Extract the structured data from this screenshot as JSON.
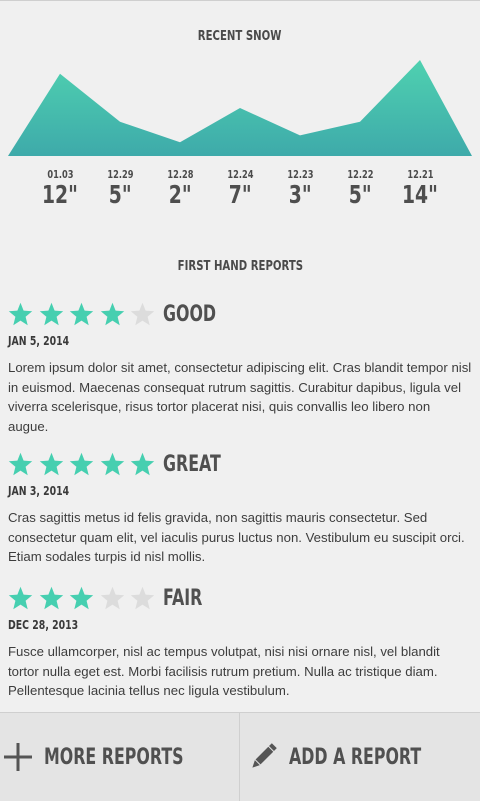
{
  "recent_snow": {
    "title": "RECENT SNOW",
    "colors": {
      "area_top": "#4fd1b0",
      "area_bottom": "#3eaaaa"
    },
    "chart_data": {
      "type": "area",
      "title": "RECENT SNOW",
      "x": [
        "01.03",
        "12.29",
        "12.28",
        "12.24",
        "12.23",
        "12.22",
        "12.21"
      ],
      "values": [
        12,
        5,
        2,
        7,
        3,
        5,
        14
      ],
      "value_labels": [
        "12\"",
        "5\"",
        "2\"",
        "7\"",
        "3\"",
        "5\"",
        "14\""
      ],
      "unit": "inches"
    }
  },
  "reports": {
    "title": "FIRST HAND REPORTS",
    "star_colors": {
      "filled": "#46cfb0",
      "empty": "#dcdcdc"
    },
    "items": [
      {
        "rating": 4,
        "max": 5,
        "label": "GOOD",
        "date": "JAN 5, 2014",
        "text": "Lorem ipsum dolor sit amet, consectetur adipiscing elit. Cras blandit tempor nisl in euismod. Maecenas consequat rutrum sagittis. Curabitur dapibus, ligula vel viverra scelerisque, risus tortor placerat nisi, quis convallis leo libero non augue."
      },
      {
        "rating": 5,
        "max": 5,
        "label": "GREAT",
        "date": "JAN 3, 2014",
        "text": "Cras sagittis metus id felis gravida, non sagittis mauris consectetur. Sed consectetur quam elit, vel iaculis purus luctus non. Vestibulum eu suscipit orci. Etiam sodales turpis id nisl mollis."
      },
      {
        "rating": 3,
        "max": 5,
        "label": "FAIR",
        "date": "DEC 28, 2013",
        "text": "Fusce ullamcorper, nisl ac tempus volutpat, nisi nisi ornare nisl, vel blandit tortor nulla eget est. Morbi facilisis rutrum pretium. Nulla ac tristique diam. Pellentesque lacinia tellus nec ligula vestibulum."
      }
    ]
  },
  "actions": {
    "more_reports": {
      "label": "MORE REPORTS",
      "icon": "plus-icon"
    },
    "add_report": {
      "label": "ADD A REPORT",
      "icon": "pencil-icon"
    }
  }
}
